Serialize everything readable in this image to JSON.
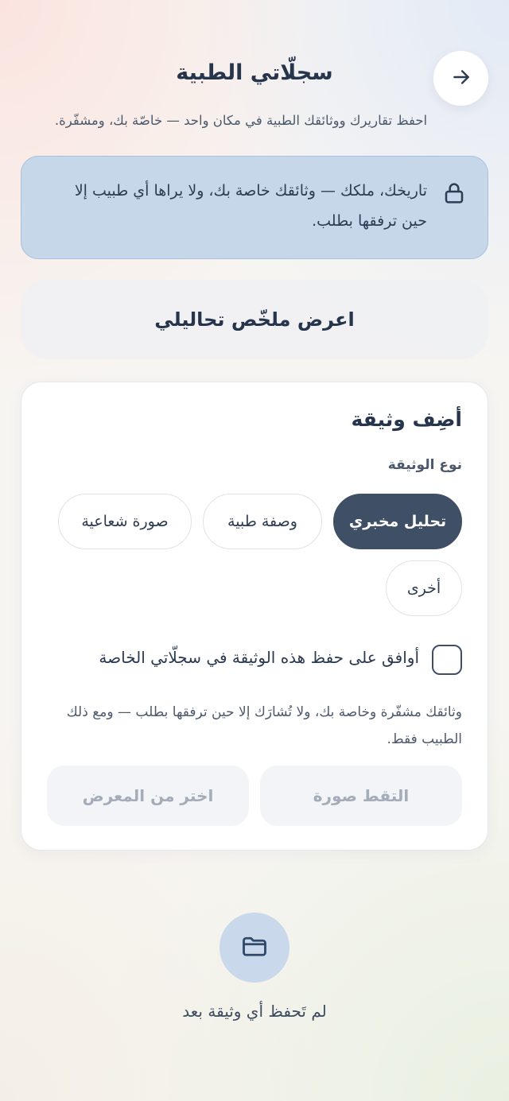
{
  "header": {
    "title": "سجلّاتي الطبية",
    "subtitle": "احفظ تقاريرك ووثائقك الطبية في مكان واحد — خاصّة بك، ومشفّرة.",
    "back_icon": "arrow-right-icon"
  },
  "privacy_banner": {
    "text": "تاريخك، ملكك — وثائقك خاصة بك، ولا يراها أي طبيب إلا حين ترفقها بطلب.",
    "icon": "lock-icon"
  },
  "summary_button": {
    "label": "اعرض ملخّص تحاليلي"
  },
  "add_document": {
    "title": "أضِف وثيقة",
    "type_label": "نوع الوثيقة",
    "types": [
      {
        "label": "تحليل مخبري",
        "selected": true
      },
      {
        "label": "وصفة طبية",
        "selected": false
      },
      {
        "label": "صورة شعاعية",
        "selected": false
      },
      {
        "label": "أخرى",
        "selected": false
      }
    ],
    "consent_label": "أوافق على حفظ هذه الوثيقة في سجلّاتي الخاصة",
    "consent_checked": false,
    "note": "وثائقك مشفّرة وخاصة بك، ولا تُشارَك إلا حين ترفقها بطلب — ومع ذلك الطبيب فقط.",
    "capture_label": "التقط صورة",
    "gallery_label": "اختر من المعرض"
  },
  "empty_state": {
    "text": "لم تَحفظ أي وثيقة بعد",
    "icon": "folder-icon"
  },
  "colors": {
    "accent": "#3f4f65",
    "banner_bg": "#c6d7ea",
    "text": "#26354b",
    "disabled_text": "#a3acb8"
  }
}
